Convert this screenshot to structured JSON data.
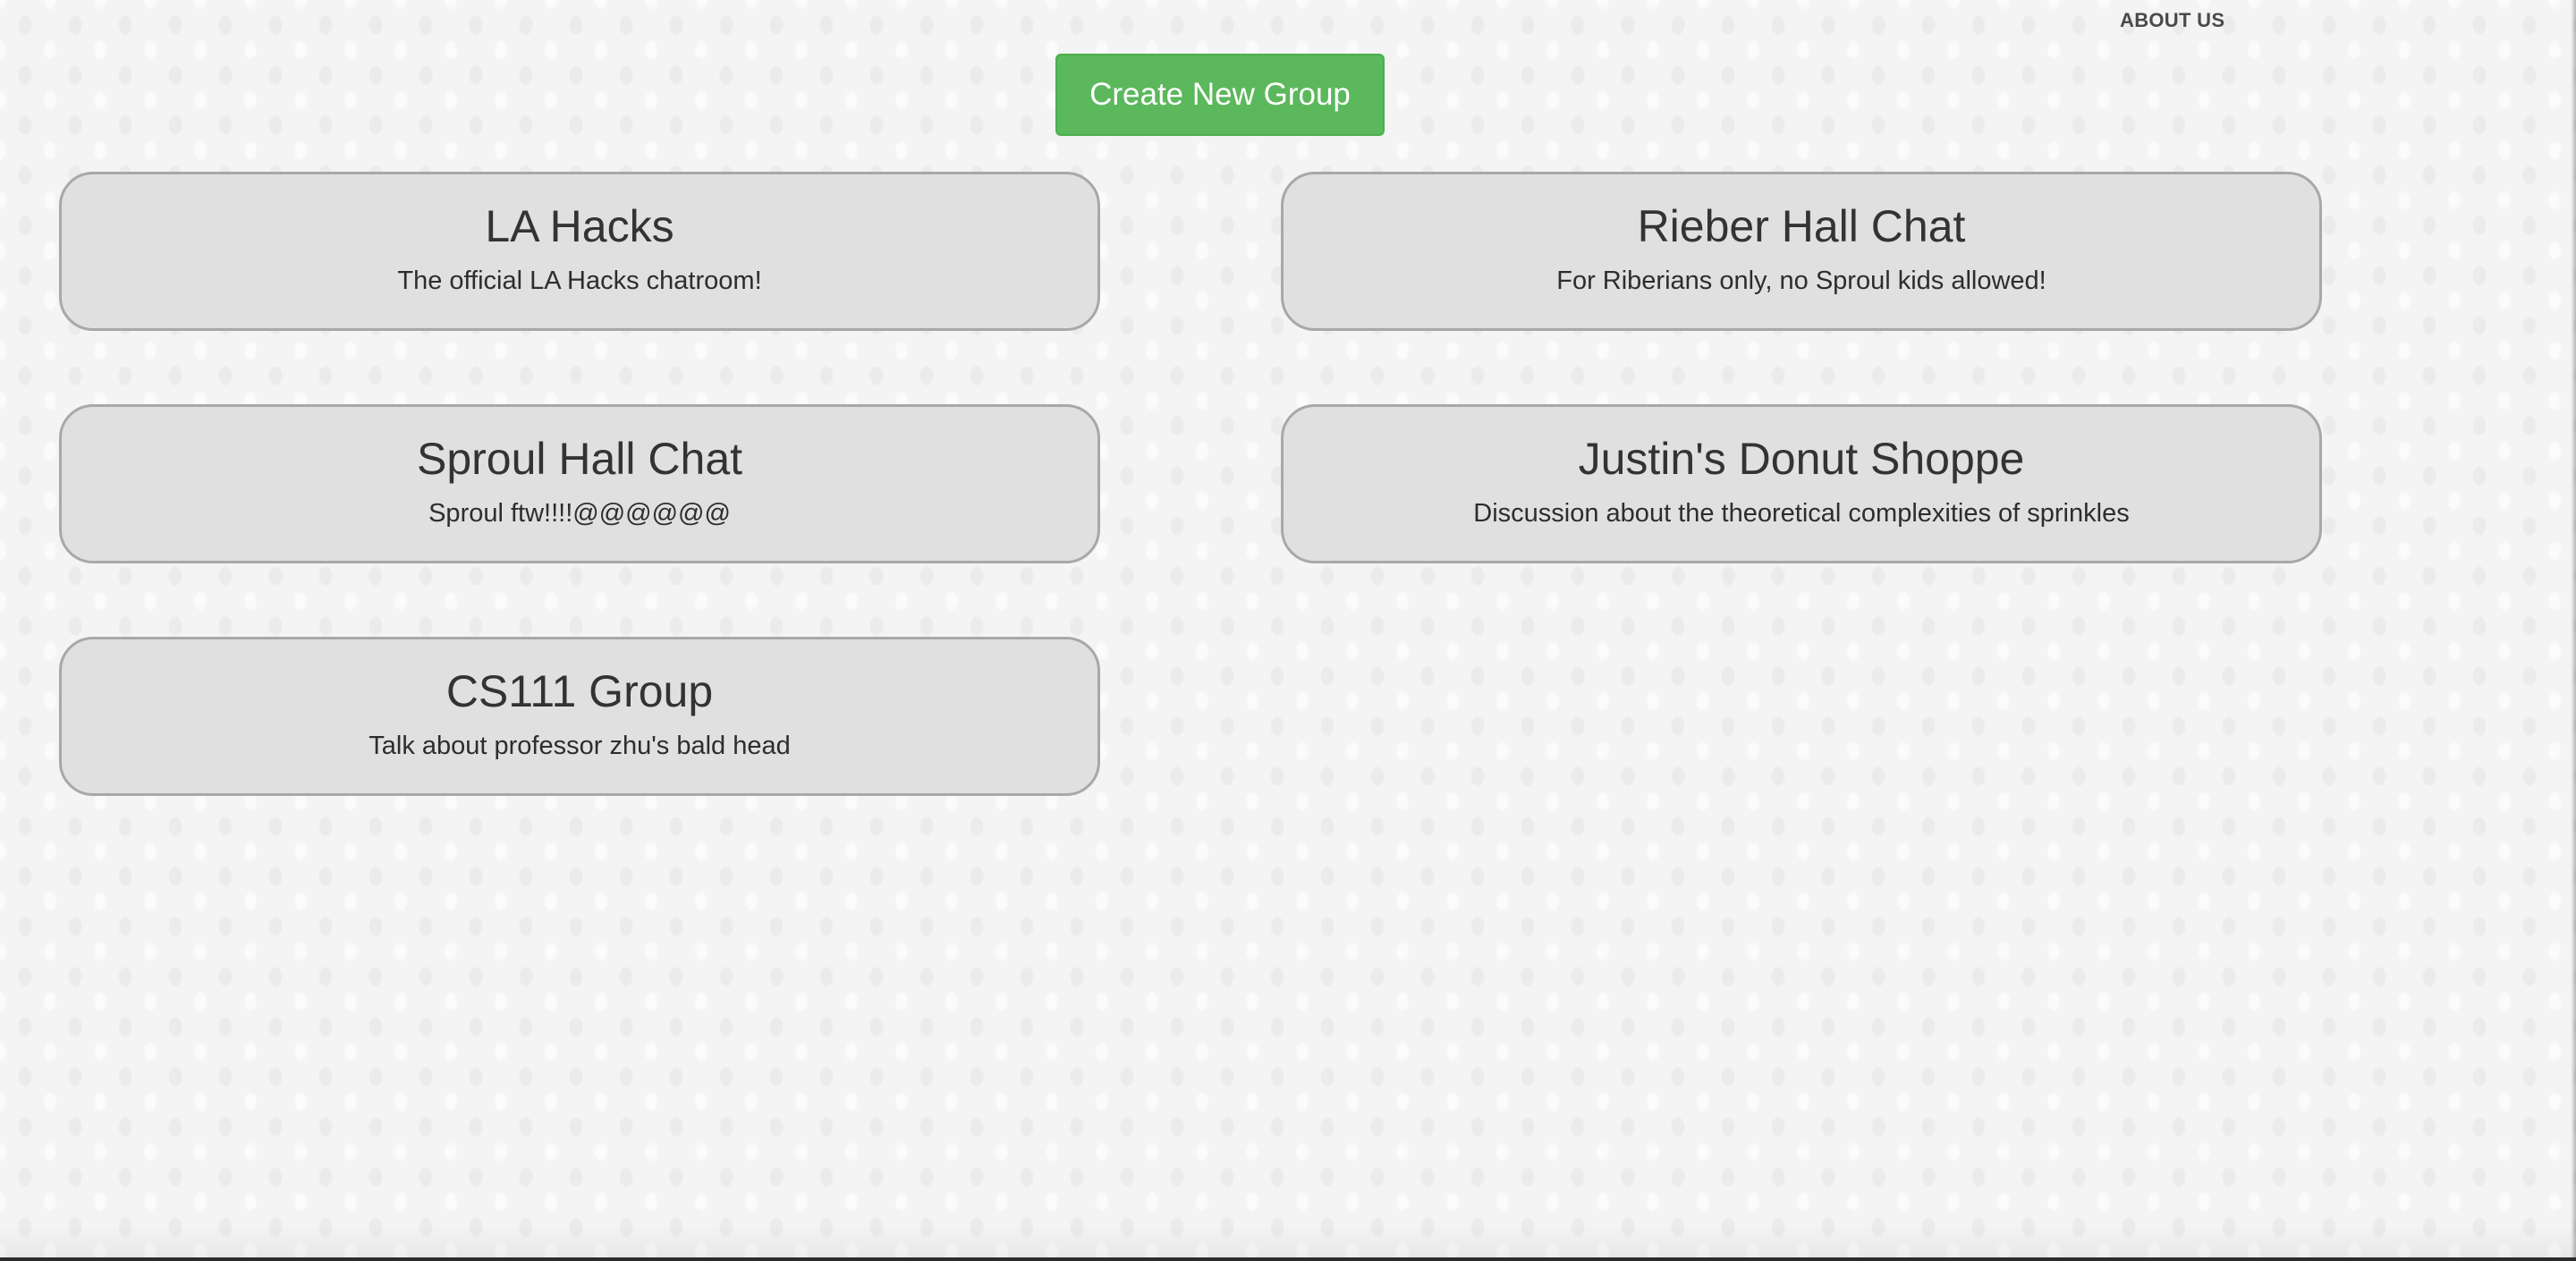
{
  "nav": {
    "about_label": "ABOUT US"
  },
  "actions": {
    "create_group_label": "Create New Group"
  },
  "groups": [
    {
      "title": "LA Hacks",
      "description": "The official LA Hacks chatroom!"
    },
    {
      "title": "Rieber Hall Chat",
      "description": "For Riberians only, no Sproul kids allowed!"
    },
    {
      "title": "Sproul Hall Chat",
      "description": "Sproul ftw!!!!@@@@@@"
    },
    {
      "title": "Justin's Donut Shoppe",
      "description": "Discussion about the theoretical complexities of sprinkles"
    },
    {
      "title": "CS111 Group",
      "description": "Talk about professor zhu's bald head"
    }
  ],
  "colors": {
    "create_button": "#5cb85c",
    "card_background": "#e0e0e0",
    "card_border": "#a8a8a8"
  }
}
